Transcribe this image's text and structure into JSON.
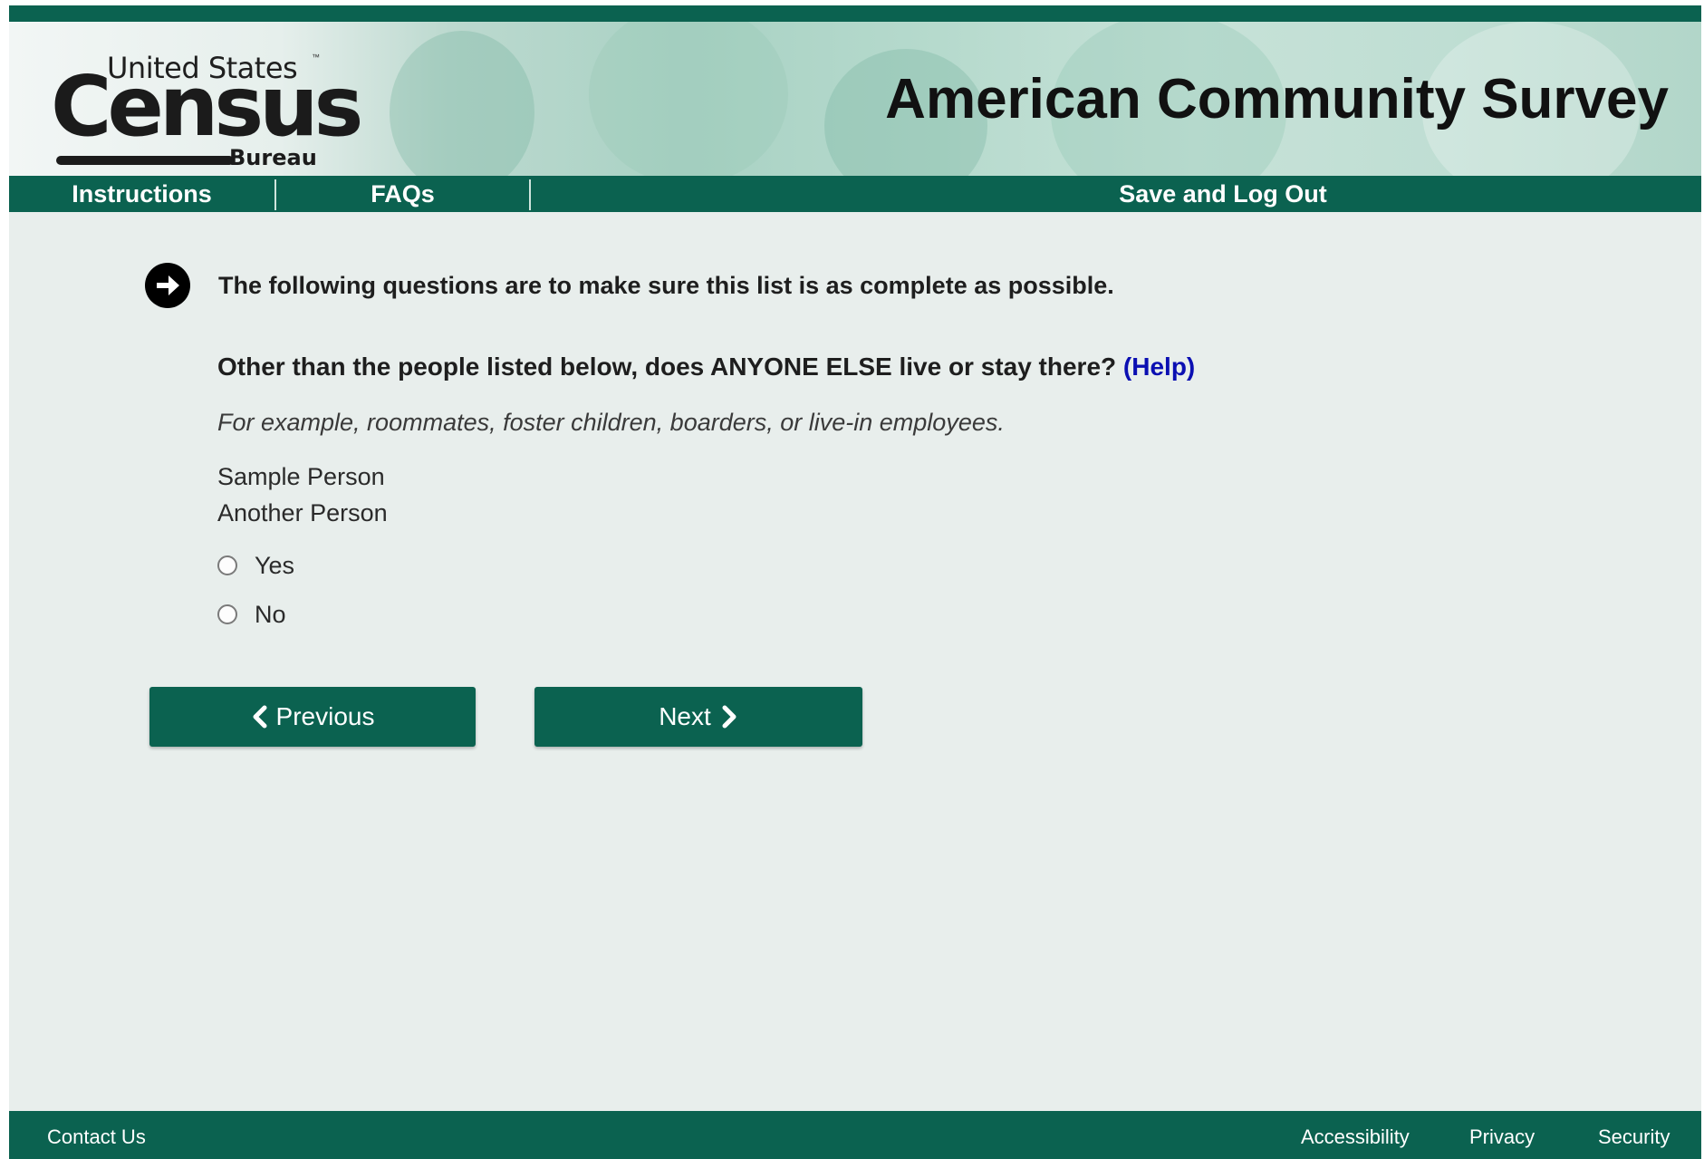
{
  "header": {
    "logo": {
      "top_text": "United States",
      "trademark": "™",
      "main_text": "Census",
      "bottom_text": "Bureau"
    },
    "title": "American Community Survey"
  },
  "nav": {
    "items": [
      {
        "label": "Instructions"
      },
      {
        "label": "FAQs"
      },
      {
        "label": "Save and Log Out"
      }
    ]
  },
  "main": {
    "intro_icon": "arrow-right-circle-icon",
    "intro": "The following questions are to make sure this list is as complete as possible.",
    "question": "Other than the people listed below, does ANYONE ELSE live or stay there?",
    "help_link": "(Help)",
    "example": "For example, roommates, foster children, boarders, or live-in employees.",
    "people": [
      "Sample Person",
      "Another Person"
    ],
    "options": [
      {
        "label": "Yes",
        "selected": false
      },
      {
        "label": "No",
        "selected": false
      }
    ],
    "buttons": {
      "previous": "Previous",
      "next": "Next"
    }
  },
  "footer": {
    "contact": "Contact Us",
    "links": [
      "Accessibility",
      "Privacy",
      "Security"
    ]
  },
  "colors": {
    "brand_green": "#0b6250",
    "help_link": "#0b0fb2",
    "page_background": "#e8eeec"
  }
}
